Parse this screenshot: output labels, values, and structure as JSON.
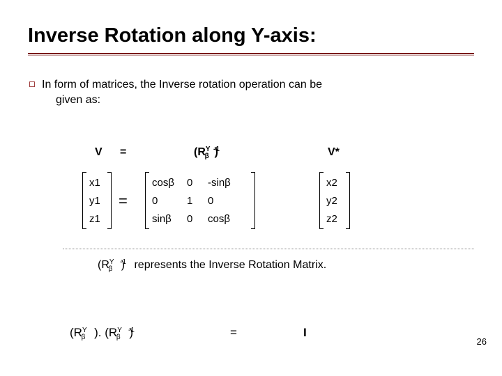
{
  "title": "Inverse Rotation along Y-axis:",
  "intro_line1": "In form of matrices, the Inverse rotation operation can be",
  "intro_line2": "given as:",
  "labels": {
    "V": "V",
    "equals": "=",
    "R_open": "(R",
    "R_sup": "Y",
    "R_sub": "β",
    "R_close_exp": ")",
    "R_exp": "-1",
    "Vstar": "V*"
  },
  "vector1": [
    "x1",
    "y1",
    "z1"
  ],
  "big_equals": "=",
  "matrix": {
    "r1": {
      "c1": "cosβ",
      "c2": "0",
      "c3": "-sinβ"
    },
    "r2": {
      "c1": "0",
      "c2": "1",
      "c3": "0"
    },
    "r3": {
      "c1": "sinβ",
      "c2": "0",
      "c3": "cosβ"
    }
  },
  "vector2": [
    "x2",
    "y2",
    "z2"
  ],
  "note": {
    "pre": "(R",
    "sup": "Y",
    "sub": "β",
    "mid": " )",
    "exp": "-1",
    "text": " represents the Inverse Rotation Matrix."
  },
  "identity": {
    "lhs_a_open": "(R",
    "lhs_a_sup": "Y",
    "lhs_a_sub": "β",
    "lhs_a_close": " ).",
    "lhs_b_open": "(R",
    "lhs_b_sup": "Y",
    "lhs_b_sub": "β",
    "lhs_b_close": " )",
    "lhs_b_exp": "-1",
    "eq": "=",
    "rhs": "I"
  },
  "pagenum": "26"
}
